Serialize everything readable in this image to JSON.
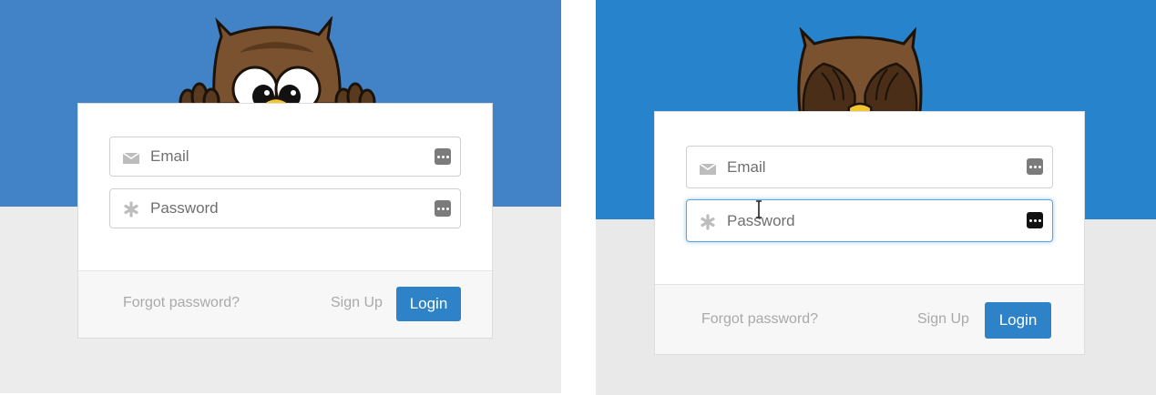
{
  "left": {
    "email_placeholder": "Email",
    "password_placeholder": "Password",
    "forgot_label": "Forgot password?",
    "signup_label": "Sign Up",
    "login_label": "Login",
    "owl_state": "peeking"
  },
  "right": {
    "email_placeholder": "Email",
    "password_placeholder": "Password",
    "forgot_label": "Forgot password?",
    "signup_label": "Sign Up",
    "login_label": "Login",
    "owl_state": "covering-eyes",
    "focused_field": "password"
  },
  "colors": {
    "left_sky": "#4282c7",
    "right_sky": "#2783cb",
    "button": "#2e82c8",
    "owl_brown": "#7a5230",
    "beak": "#f3c52e"
  },
  "icons": [
    "envelope-icon",
    "asterisk-icon",
    "password-manager-icon",
    "owl-mascot",
    "text-cursor-icon"
  ]
}
